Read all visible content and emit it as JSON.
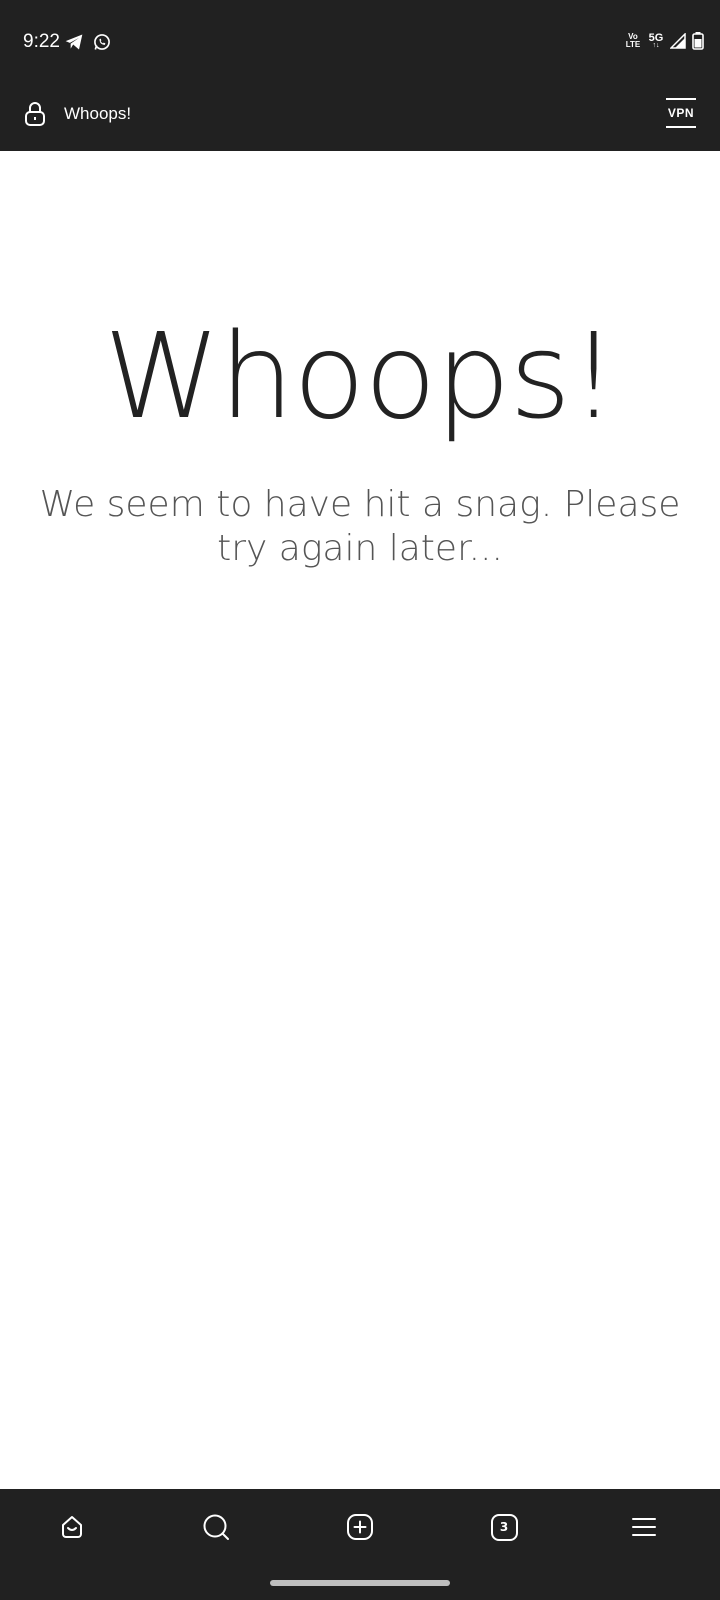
{
  "status_bar": {
    "time": "9:22",
    "left_icons": [
      "telegram-icon",
      "whatsapp-icon"
    ],
    "volte_top": "Vo",
    "volte_bottom": "LTE",
    "network": "5G",
    "right_icons": [
      "signal-icon",
      "battery-icon"
    ]
  },
  "address_bar": {
    "icon": "lock-icon",
    "title": "Whoops!",
    "vpn_label": "VPN"
  },
  "page": {
    "heading": "Whoops!",
    "message": "We seem to have hit a snag. Please try again later..."
  },
  "bottom_nav": {
    "items": [
      {
        "icon": "home-icon"
      },
      {
        "icon": "search-icon"
      },
      {
        "icon": "new-tab-icon"
      },
      {
        "icon": "tabs-icon",
        "count": "3"
      },
      {
        "icon": "menu-icon"
      }
    ]
  },
  "colors": {
    "bar_background": "#212121",
    "page_background": "#ffffff",
    "heading_text": "#222222",
    "message_text": "#555555"
  }
}
